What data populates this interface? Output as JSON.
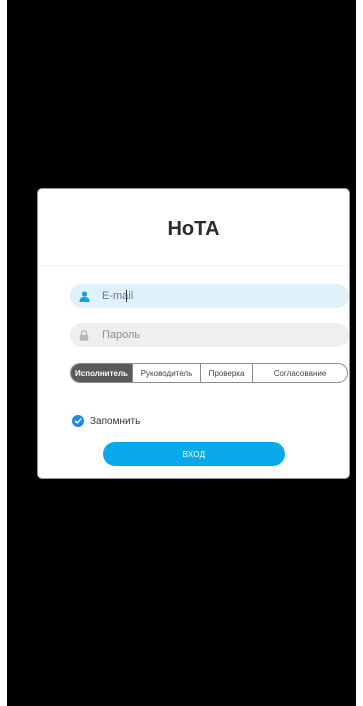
{
  "login": {
    "title": "НоТА",
    "email_placeholder": "E-mail",
    "password_placeholder": "Пароль",
    "roles": [
      {
        "label": "Исполнитель",
        "active": true
      },
      {
        "label": "Руководитель",
        "active": false
      },
      {
        "label": "Проверка",
        "active": false
      },
      {
        "label": "Согласование",
        "active": false
      }
    ],
    "remember_label": "Запомнить",
    "remember_checked": true,
    "submit_label": "ВХОД"
  },
  "icons": {
    "email": "user-icon",
    "password": "lock-icon",
    "remember": "check-icon"
  },
  "colors": {
    "accent": "#09a9ec",
    "user_icon": "#1e9be0",
    "checkbox": "#1e88e5",
    "active_role_bg": "#5a5a5a",
    "email_field_bg": "#dff2fb",
    "password_field_bg": "#efefef",
    "screen_bg": "#000000"
  }
}
